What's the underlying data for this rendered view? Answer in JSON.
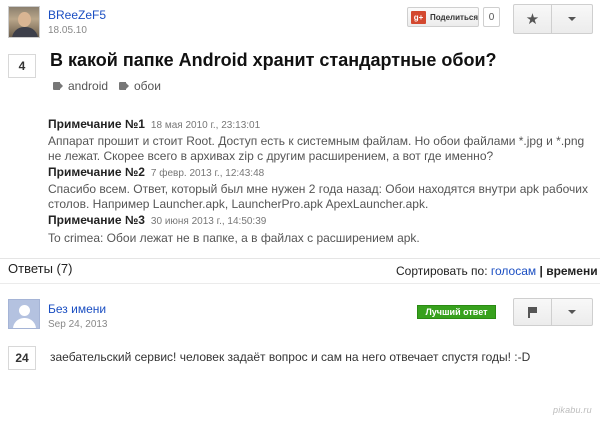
{
  "question": {
    "author": "BReeZeF5",
    "author_date": "18.05.10",
    "share_label": "Поделиться",
    "share_count": "0",
    "votes": "4",
    "title": "В какой папке Android хранит стандартные обои?",
    "tags": [
      "android",
      "обои"
    ]
  },
  "notes": [
    {
      "label": "Примечание №1",
      "date": "18 мая 2010 г., 23:13:01",
      "text": "Аппарат прошит и стоит Root. Доступ есть к системным файлам. Но обои файлами *.jpg и *.png не лежат. Скорее всего в архивах zip с другим расширением, а вот где именно?"
    },
    {
      "label": "Примечание №2",
      "date": "7 февр. 2013 г., 12:43:48",
      "text": "Спасибо всем. Ответ, который был мне нужен 2 года назад: Обои находятся внутри apk рабочих столов. Например Launcher.apk, LauncherPro.apk ApexLauncher.apk."
    },
    {
      "label": "Примечание №3",
      "date": "30 июня 2013 г., 14:50:39",
      "text": "To crimea: Обои лежат не в папке, а в файлах с расширением apk."
    }
  ],
  "answers": {
    "heading": "Ответы (7)",
    "sort_label": "Сортировать по:",
    "sort_votes": "голосам",
    "sort_separator": "|",
    "sort_time": "времени",
    "items": [
      {
        "author": "Без имени",
        "date": "Sep 24, 2013",
        "badge": "Лучший ответ",
        "votes": "24",
        "text": "заебательский сервис! человек задаёт вопрос и сам на него отвечает спустя годы! :-D"
      }
    ]
  },
  "icons": {
    "star": "★",
    "gplus": "g+"
  },
  "colors": {
    "link": "#1a4ec2",
    "best_badge": "#37a11d",
    "gplus": "#d3482f"
  },
  "watermark": "pikabu.ru"
}
